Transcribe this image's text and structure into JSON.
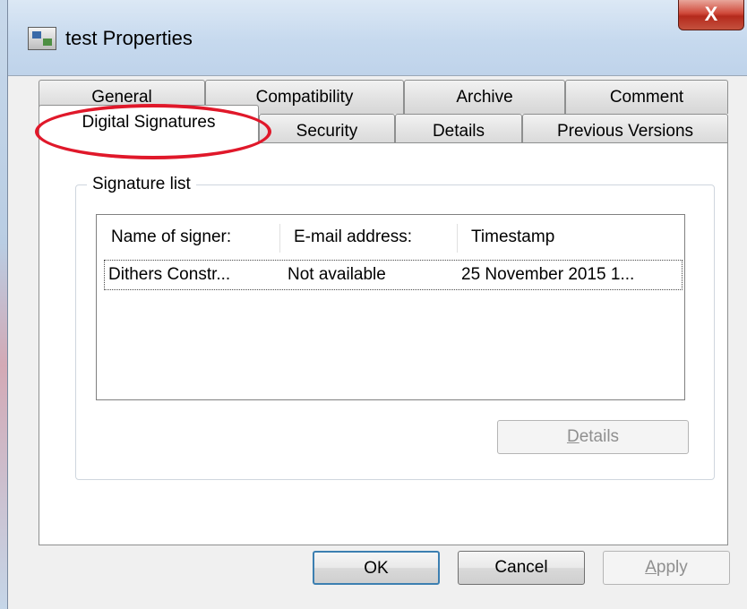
{
  "window": {
    "title": "test Properties",
    "close_glyph": "X"
  },
  "tabs": {
    "row1": [
      "General",
      "Compatibility",
      "Archive",
      "Comment"
    ],
    "row2": [
      "Digital Signatures",
      "Security",
      "Details",
      "Previous Versions"
    ],
    "active": "Digital Signatures"
  },
  "signature_list": {
    "label": "Signature list",
    "columns": [
      "Name of signer:",
      "E-mail address:",
      "Timestamp"
    ],
    "rows": [
      {
        "name": "Dithers Constr...",
        "email": "Not available",
        "timestamp": "25 November 2015 1..."
      }
    ],
    "details_button": {
      "prefix": "",
      "accel": "D",
      "rest": "etails"
    }
  },
  "footer": {
    "ok": "OK",
    "cancel": "Cancel",
    "apply": {
      "accel": "A",
      "rest": "pply"
    }
  },
  "colors": {
    "highlight_oval": "#e0182a",
    "title_bar": "#c6d9ee",
    "close_button": "#c4392a"
  },
  "icons": {
    "title": "properties-window-icon",
    "close": "close-icon"
  }
}
